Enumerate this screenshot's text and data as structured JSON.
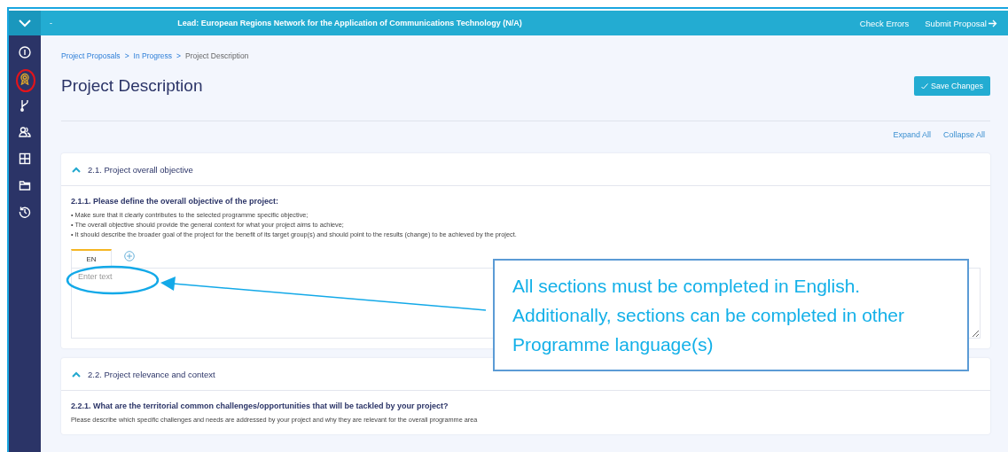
{
  "topbar": {
    "separator": "-",
    "lead": "Lead: European Regions Network for the Application of Communications Technology (N/A)",
    "actions": [
      {
        "label": "Check Errors",
        "kind": "plain"
      },
      {
        "label": "Submit Proposal",
        "kind": "forward"
      }
    ]
  },
  "sidebar": {
    "items": [
      {
        "kind": "info",
        "selected": false
      },
      {
        "kind": "badge",
        "selected": true
      },
      {
        "kind": "fork",
        "selected": false
      },
      {
        "kind": "users",
        "selected": false
      },
      {
        "kind": "grid",
        "selected": false
      },
      {
        "kind": "folder",
        "selected": false
      },
      {
        "kind": "history",
        "selected": false
      }
    ]
  },
  "breadcrumb": [
    {
      "label": "Project Proposals",
      "link": true
    },
    {
      "label": "In Progress",
      "link": true
    },
    {
      "label": "Project Description",
      "link": false
    }
  ],
  "breadcrumb_separator": ">",
  "title": "Project Description",
  "save_button": "Save Changes",
  "expand_all": "Expand All",
  "collapse_all": "Collapse All",
  "sections": [
    {
      "title": "2.1. Project overall objective",
      "expanded": true,
      "question": "2.1.1. Please define the overall objective of the project:",
      "hints": [
        "• Make sure that it clearly contributes to the selected programme specific objective;",
        "• The overall objective should provide the general context for what your project aims to achieve;",
        "• It should describe the broader goal of the project for the benefit of its target group(s) and should point to the results (change) to be achieved by the project."
      ],
      "language_tabs": [
        {
          "label": "EN",
          "selected": true
        }
      ],
      "placeholder": "Enter text"
    },
    {
      "title": "2.2. Project relevance and context",
      "expanded": true,
      "question": "2.2.1. What are the territorial common challenges/opportunities that will be tackled by your project?",
      "hints": [
        "Please describe which specific challenges and needs are addressed by your project and why they are relevant for the overall programme area"
      ]
    }
  ],
  "annotation": {
    "text": "All sections must be completed in English. Additionally, sections can be completed in other Programme language(s)"
  }
}
